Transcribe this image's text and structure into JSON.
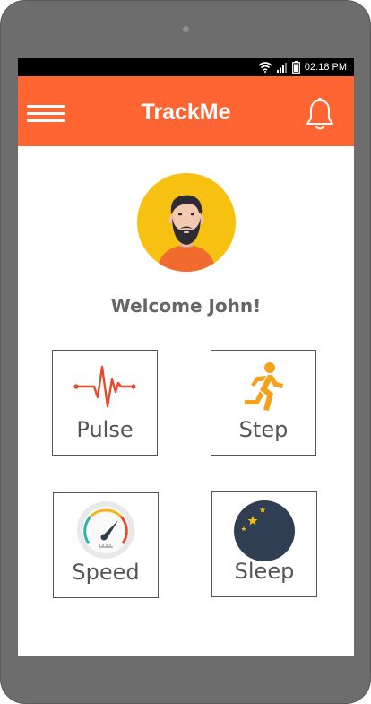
{
  "status_bar": {
    "time": "02:18 PM",
    "icons": [
      "wifi-icon",
      "signal-icon",
      "battery-icon"
    ]
  },
  "app_bar": {
    "title": "TrackMe",
    "left_icon": "hamburger-menu-icon",
    "right_icon": "bell-icon"
  },
  "profile": {
    "welcome": "Welcome John!",
    "avatar_icon": "bearded-man-avatar"
  },
  "tiles": [
    {
      "label": "Pulse",
      "icon": "pulse-heartbeat-icon"
    },
    {
      "label": "Step",
      "icon": "running-person-icon"
    },
    {
      "label": "Speed",
      "icon": "speedometer-icon"
    },
    {
      "label": "Sleep",
      "icon": "moon-stars-icon"
    }
  ],
  "colors": {
    "accent": "#ff6533",
    "avatar_bg": "#f6c111",
    "device_frame": "#6d6d6d",
    "text": "#666666"
  }
}
